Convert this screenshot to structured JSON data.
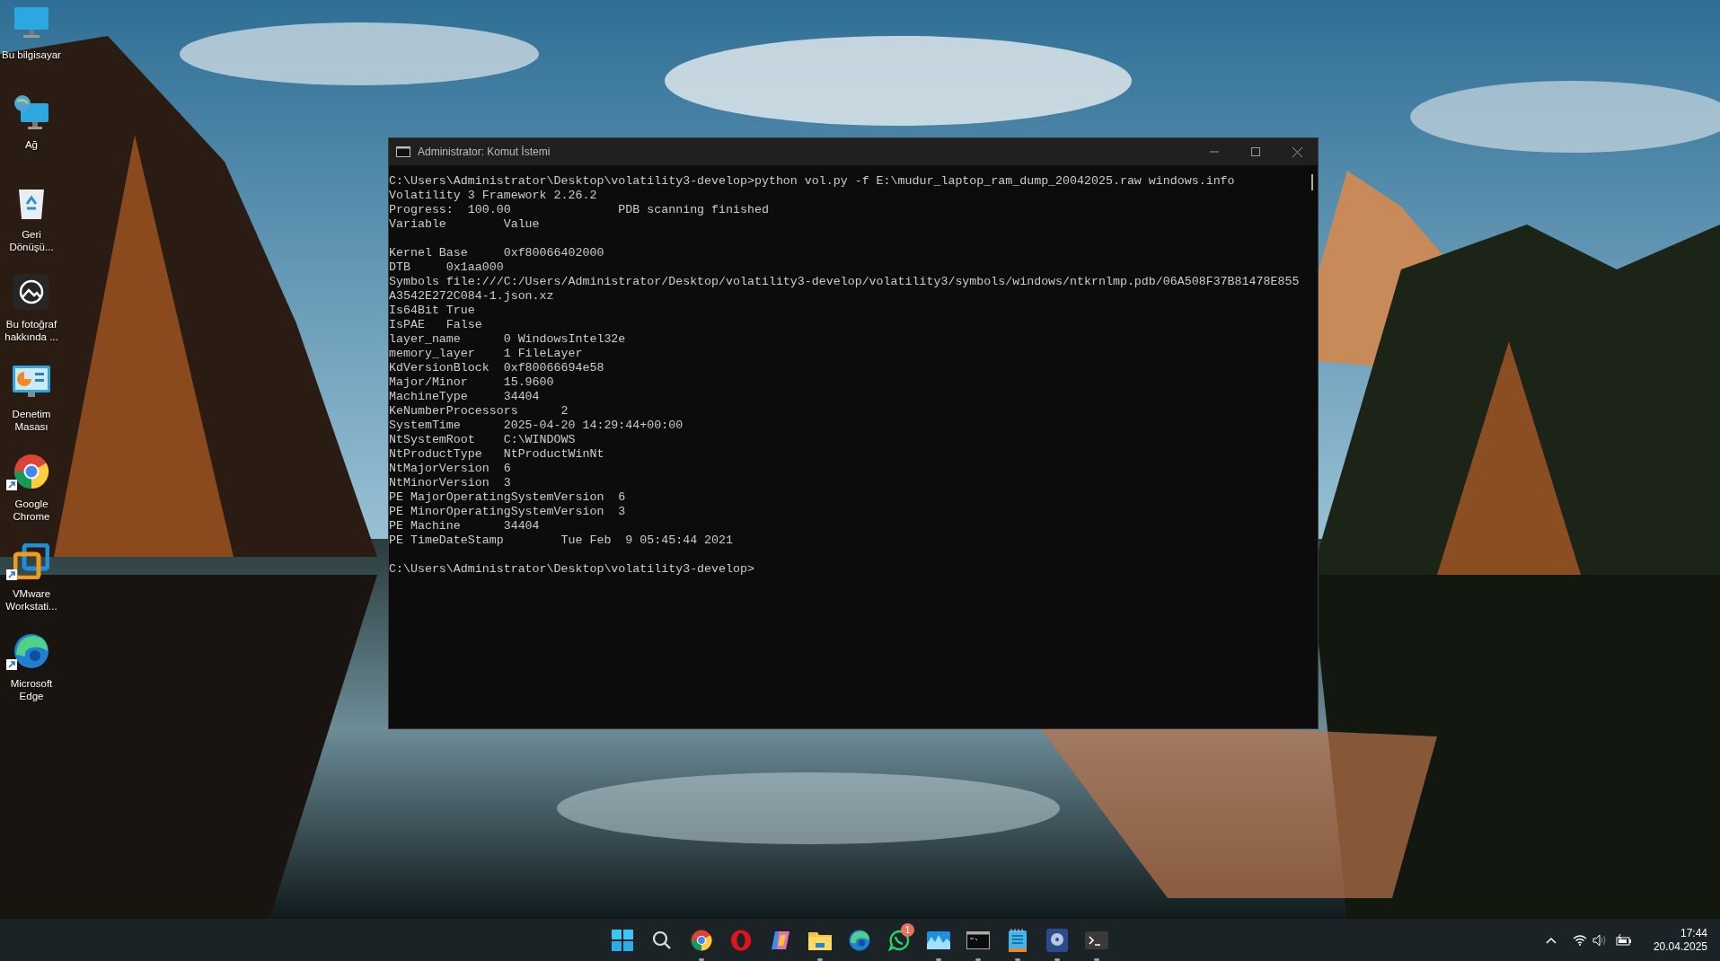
{
  "desktop_icons": [
    {
      "kind": "computer",
      "label": "Bu bilgisayar",
      "shortcut": false
    },
    {
      "kind": "network",
      "label": "Ağ",
      "shortcut": false
    },
    {
      "kind": "recycle",
      "label": "Geri Dönüşü...",
      "shortcut": false
    },
    {
      "label": "Bu fotoğraf hakkında ...",
      "shortcut": false
    },
    {
      "kind": "control",
      "label": "Denetim Masası",
      "shortcut": false
    },
    {
      "kind": "chrome",
      "label": "Google Chrome",
      "shortcut": true
    },
    {
      "kind": "vmware",
      "label": "VMware Workstati...",
      "shortcut": true
    },
    {
      "kind": "edge",
      "label": "Microsoft Edge",
      "shortcut": true
    }
  ],
  "window": {
    "title": "Administrator: Komut İstemi",
    "blocks": [
      [
        "C:\\Users\\Administrator\\Desktop\\volatility3-develop>python vol.py -f E:\\mudur_laptop_ram_dump_20042025.raw windows.info",
        "Volatility 3 Framework 2.26.2",
        "Progress:  100.00               PDB scanning finished",
        "Variable        Value"
      ],
      [
        "Kernel Base     0xf80066402000",
        "DTB     0x1aa000",
        "Symbols file:///C:/Users/Administrator/Desktop/volatility3-develop/volatility3/symbols/windows/ntkrnlmp.pdb/06A508F37B81478E855",
        "A3542E272C084-1.json.xz",
        "Is64Bit True",
        "IsPAE   False",
        "layer_name      0 WindowsIntel32e",
        "memory_layer    1 FileLayer",
        "KdVersionBlock  0xf80066694e58",
        "Major/Minor     15.9600",
        "MachineType     34404",
        "KeNumberProcessors      2",
        "SystemTime      2025-04-20 14:29:44+00:00",
        "NtSystemRoot    C:\\WINDOWS",
        "NtProductType   NtProductWinNt",
        "NtMajorVersion  6",
        "NtMinorVersion  3",
        "PE MajorOperatingSystemVersion  6",
        "PE MinorOperatingSystemVersion  3",
        "PE Machine      34404",
        "PE TimeDateStamp        Tue Feb  9 05:45:44 2021"
      ],
      [
        "C:\\Users\\Administrator\\Desktop\\volatility3-develop>"
      ]
    ]
  },
  "taskbar": {
    "apps": [
      {
        "kind": "start",
        "running": false
      },
      {
        "kind": "search",
        "running": false
      },
      {
        "kind": "chrome",
        "running": true
      },
      {
        "kind": "opera",
        "running": false
      },
      {
        "kind": "copilot",
        "running": false
      },
      {
        "kind": "folder",
        "running": true
      },
      {
        "kind": "edge",
        "running": false
      },
      {
        "kind": "whatsapp",
        "running": false,
        "badge": "1"
      },
      {
        "kind": "monitor",
        "running": true
      },
      {
        "kind": "cmd",
        "running": true
      },
      {
        "kind": "notepad",
        "running": true
      },
      {
        "kind": "disk",
        "running": true
      },
      {
        "kind": "terminal",
        "running": true
      }
    ],
    "time": "17:44",
    "date": "20.04.2025"
  }
}
